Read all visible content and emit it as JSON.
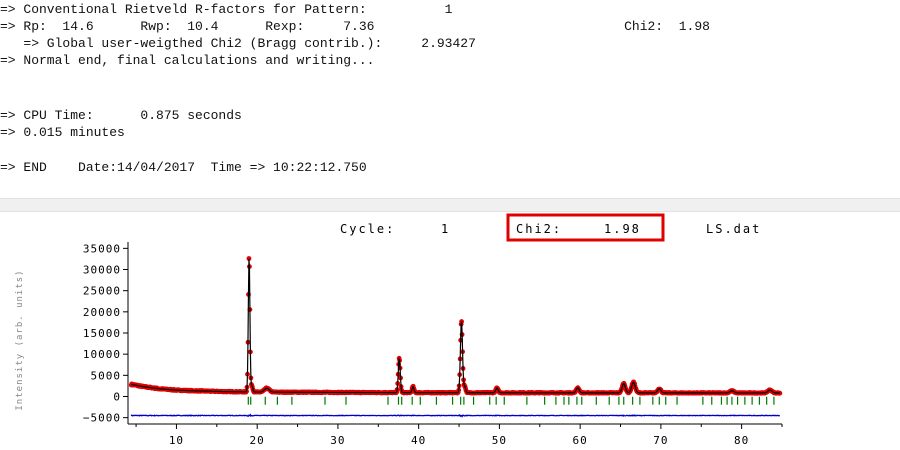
{
  "console": {
    "lines": [
      {
        "text": "=> Conventional Rietveld R-factors for Pattern:          1"
      },
      {
        "text": "=> Rp:  14.6      Rwp:  10.4      Rexp:     7.36                                Chi2:  1.98"
      },
      {
        "text": "   => Global user-weigthed Chi2 (Bragg contrib.):     2.93427"
      },
      {
        "text": "=> Normal end, final calculations and writing..."
      },
      {
        "text": "=> CPU Time:      0.875 seconds"
      },
      {
        "text": "=> 0.015 minutes"
      },
      {
        "text": "=> END    Date:14/04/2017  Time => 10:22:12.750"
      }
    ]
  },
  "plot_header": {
    "cycle_label": "Cycle:",
    "cycle_value": "1",
    "chi2_label": "Chi2:",
    "chi2_value": "1.98",
    "file": "LS.dat"
  },
  "colors": {
    "observed": "#e00000",
    "calculated": "#000000",
    "bragg": "#007a00",
    "difference": "#0000cc",
    "highlight_box": "#e00000"
  },
  "chart_data": {
    "type": "scatter",
    "ylabel": "Intensity (arb. units)",
    "xlim": [
      4,
      85
    ],
    "ylim": [
      -6500,
      36500
    ],
    "x_ticks": [
      10,
      20,
      30,
      40,
      50,
      60,
      70,
      80
    ],
    "y_ticks": [
      35000,
      30000,
      25000,
      20000,
      15000,
      10000,
      5000,
      0,
      -5000
    ],
    "background": {
      "x": [
        4,
        6,
        8,
        10,
        12,
        14,
        16,
        18,
        20,
        25,
        30,
        40,
        50,
        60,
        70,
        80,
        85
      ],
      "y": [
        3000,
        2300,
        1800,
        1500,
        1350,
        1250,
        1150,
        1100,
        1050,
        1000,
        950,
        900,
        880,
        860,
        850,
        840,
        830
      ]
    },
    "peaks": [
      {
        "x": 19.0,
        "height": 32000,
        "width": 0.1
      },
      {
        "x": 19.35,
        "height": 1500,
        "width": 0.1
      },
      {
        "x": 21.2,
        "height": 900,
        "width": 0.3
      },
      {
        "x": 37.6,
        "height": 8200,
        "width": 0.12
      },
      {
        "x": 39.3,
        "height": 1400,
        "width": 0.12
      },
      {
        "x": 45.3,
        "height": 17000,
        "width": 0.13
      },
      {
        "x": 45.7,
        "height": 1500,
        "width": 0.12
      },
      {
        "x": 49.7,
        "height": 1100,
        "width": 0.15
      },
      {
        "x": 59.7,
        "height": 1200,
        "width": 0.18
      },
      {
        "x": 65.4,
        "height": 2200,
        "width": 0.2
      },
      {
        "x": 66.6,
        "height": 2500,
        "width": 0.22
      },
      {
        "x": 69.8,
        "height": 1000,
        "width": 0.2
      },
      {
        "x": 78.8,
        "height": 500,
        "width": 0.25
      },
      {
        "x": 83.5,
        "height": 700,
        "width": 0.25
      }
    ],
    "difference_offset": -4500,
    "bragg_y": -1000,
    "bragg_positions": [
      18.9,
      19.2,
      21.0,
      22.5,
      24.3,
      28.4,
      31.0,
      36.2,
      37.5,
      37.9,
      39.2,
      40.2,
      42.2,
      44.2,
      45.2,
      45.6,
      46.8,
      48.8,
      49.6,
      50.6,
      53.4,
      55.6,
      57.0,
      58.0,
      58.6,
      59.6,
      60.2,
      62.0,
      63.6,
      64.8,
      65.4,
      66.5,
      67.4,
      69.0,
      69.8,
      70.6,
      72.0,
      75.2,
      76.3,
      77.5,
      78.2,
      78.8,
      79.5,
      80.4,
      81.3,
      82.2,
      83.1,
      84.0
    ]
  }
}
